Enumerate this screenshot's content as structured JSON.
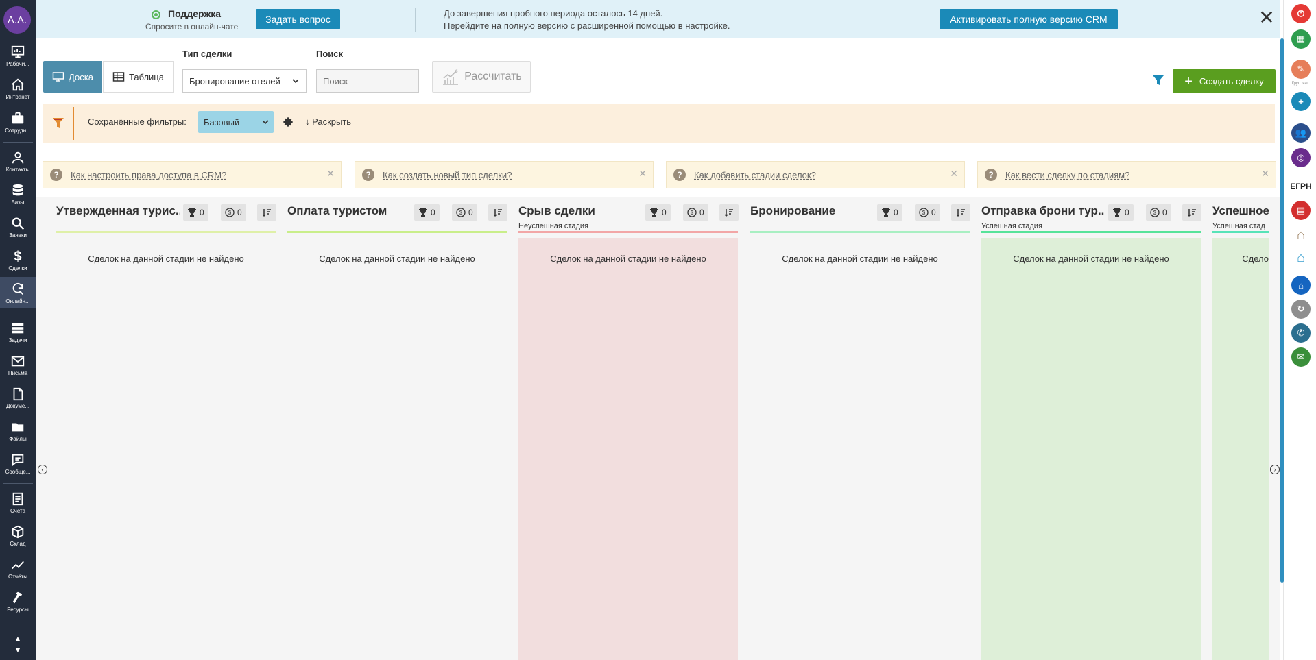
{
  "user": {
    "initials": "A.A."
  },
  "sidebar": {
    "items": [
      {
        "label": "Рабочи...",
        "icon": "dashboard-icon"
      },
      {
        "label": "Интранет",
        "icon": "home-icon"
      },
      {
        "label": "Сотрудн...",
        "icon": "employees-icon"
      },
      {
        "label": "Контакты",
        "icon": "contacts-icon"
      },
      {
        "label": "Базы",
        "icon": "database-icon"
      },
      {
        "label": "Заявки",
        "icon": "search-icon"
      },
      {
        "label": "Сделки",
        "icon": "dollar-icon"
      },
      {
        "label": "Онлайн...",
        "icon": "refresh-search-icon"
      },
      {
        "label": "Задачи",
        "icon": "tasks-icon"
      },
      {
        "label": "Письма",
        "icon": "mail-icon"
      },
      {
        "label": "Докуме...",
        "icon": "document-icon"
      },
      {
        "label": "Файлы",
        "icon": "folder-icon"
      },
      {
        "label": "Сообще...",
        "icon": "chat-icon"
      },
      {
        "label": "Счета",
        "icon": "invoice-icon"
      },
      {
        "label": "Склад",
        "icon": "box-icon"
      },
      {
        "label": "Отчёты",
        "icon": "chart-icon"
      },
      {
        "label": "Ресурсы",
        "icon": "hammer-icon"
      }
    ]
  },
  "rightbar": {
    "items": [
      {
        "icon": "power-icon",
        "color": "#e53935"
      },
      {
        "icon": "calendar-icon",
        "color": "#2e9e4f"
      },
      {
        "icon": "pen-icon",
        "color": "#e67e5a"
      },
      {
        "icon": "plus-icon",
        "color": "#1b8ab8"
      },
      {
        "icon": "group-icon",
        "color": "#2b4f8c"
      },
      {
        "icon": "globe-icon",
        "color": "#6a2c8c"
      },
      {
        "icon": "egrn-icon",
        "color": "#222222"
      },
      {
        "icon": "printer-icon",
        "color": "#d32f2f"
      },
      {
        "icon": "house-tools-icon",
        "color": "#8d6e4a"
      },
      {
        "icon": "house-outline-icon",
        "color": "#3aa0d0"
      },
      {
        "icon": "house-icon",
        "color": "#1565c0"
      },
      {
        "icon": "refresh-icon",
        "color": "#8e8e8e"
      },
      {
        "icon": "phone-icon",
        "color": "#2b6f8f"
      },
      {
        "icon": "mail-icon",
        "color": "#3b8f3b"
      }
    ],
    "small_label": "Груп. чат",
    "egrn_label": "ЕГРН"
  },
  "banner": {
    "support_title": "Поддержка",
    "support_sub": "Спросите в онлайн-чате",
    "ask_button": "Задать вопрос",
    "trial_line1": "До завершения пробного периода осталось 14 дней.",
    "trial_line2": "Перейдите на полную версию с расширенной помощью в настройке.",
    "activate_button": "Активировать полную версию CRM",
    "close": "✕"
  },
  "toolbar": {
    "view_board": "Доска",
    "view_table": "Таблица",
    "deal_type_label": "Тип сделки",
    "deal_type_value": "Бронирование отелей",
    "search_label": "Поиск",
    "search_placeholder": "Поиск",
    "calc_button": "Рассчитать",
    "create_button": "Создать сделку"
  },
  "filters": {
    "saved_label": "Сохранённые фильтры:",
    "saved_value": "Базовый",
    "expand": "Раскрыть"
  },
  "hints": [
    {
      "text": "Как настроить права доступа в CRM?"
    },
    {
      "text": "Как создать новый тип сделки?"
    },
    {
      "text": "Как добавить стадии сделок?"
    },
    {
      "text": "Как вести сделку по стадиям?"
    }
  ],
  "kanban": {
    "columns": [
      {
        "title": "Утвержденная турис...",
        "subtitle": "",
        "wins": "0",
        "sum": "0",
        "empty": "Сделок на данной стадии не найдено",
        "line_color": "#dff0a8",
        "body_color": "#f5f5f5"
      },
      {
        "title": "Оплата туристом",
        "subtitle": "",
        "wins": "0",
        "sum": "0",
        "empty": "Сделок на данной стадии не найдено",
        "line_color": "#c9ee8a",
        "body_color": "#f5f5f5"
      },
      {
        "title": "Срыв сделки",
        "subtitle": "Неуспешная стадия",
        "wins": "0",
        "sum": "0",
        "empty": "Сделок на данной стадии не найдено",
        "line_color": "#f2a6a6",
        "body_color": "#f2dede"
      },
      {
        "title": "Бронирование",
        "subtitle": "",
        "wins": "0",
        "sum": "0",
        "empty": "Сделок на данной стадии не найдено",
        "line_color": "#a8efc2",
        "body_color": "#f5f5f5"
      },
      {
        "title": "Отправка брони тур...",
        "subtitle": "Успешная стадия",
        "wins": "0",
        "sum": "0",
        "empty": "Сделок на данной стадии не найдено",
        "line_color": "#57e39a",
        "body_color": "#deefd8"
      },
      {
        "title": "Успешное",
        "subtitle": "Успешная стад",
        "wins": "",
        "sum": "",
        "empty": "Сдело",
        "line_color": "#57e3b8",
        "body_color": "#deefd8"
      }
    ]
  }
}
